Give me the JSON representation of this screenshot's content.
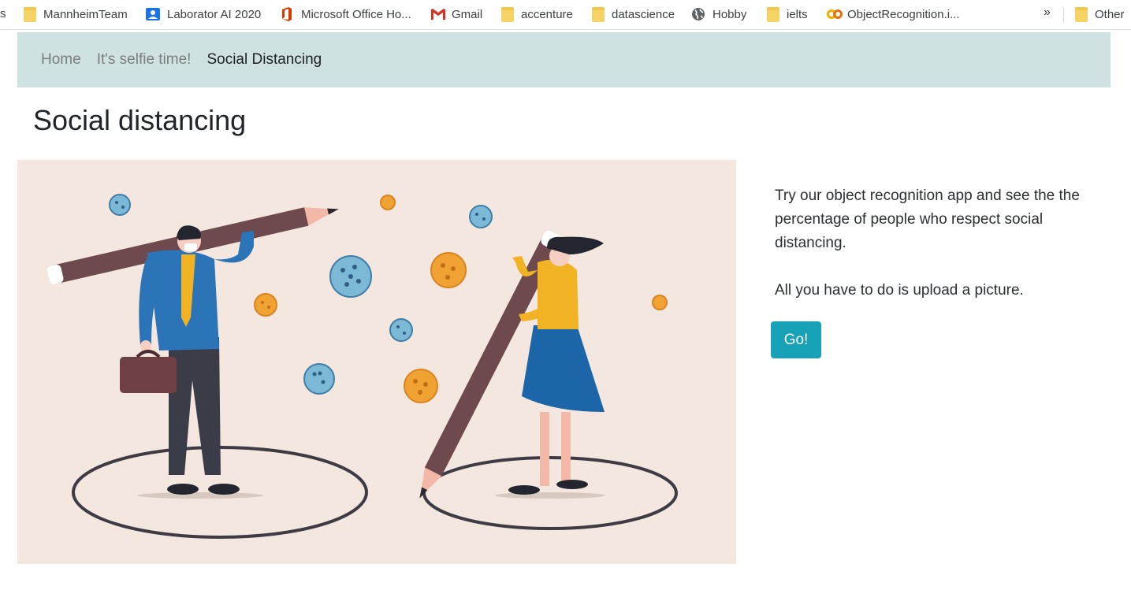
{
  "bookmarks": {
    "cut_label": "s",
    "items": [
      {
        "label": "MannheimTeam",
        "icon": "folder-icon"
      },
      {
        "label": "Laborator AI 2020",
        "icon": "classroom-icon"
      },
      {
        "label": "Microsoft Office Ho...",
        "icon": "office-icon"
      },
      {
        "label": "Gmail",
        "icon": "gmail-icon"
      },
      {
        "label": "accenture",
        "icon": "folder-icon"
      },
      {
        "label": "datascience",
        "icon": "folder-icon"
      },
      {
        "label": "Hobby",
        "icon": "globe-icon"
      },
      {
        "label": "ielts",
        "icon": "folder-icon"
      },
      {
        "label": "ObjectRecognition.i...",
        "icon": "colab-icon"
      }
    ],
    "overflow_label": "»",
    "other_label": "Other"
  },
  "navbar": {
    "links": [
      {
        "label": "Home",
        "active": false
      },
      {
        "label": "It's selfie time!",
        "active": false
      },
      {
        "label": "Social Distancing",
        "active": true
      }
    ]
  },
  "page": {
    "title": "Social distancing",
    "illustration": "social-distancing-illustration",
    "intro": "Try our object recognition app and see the the percentage of people who respect social distancing.",
    "instruction": "All you have to do is upload a picture.",
    "go_button": "Go!"
  },
  "colors": {
    "navbar_bg": "#cfe1e0",
    "button_bg": "#17a2b8",
    "illustration_bg": "#f3e7df"
  }
}
